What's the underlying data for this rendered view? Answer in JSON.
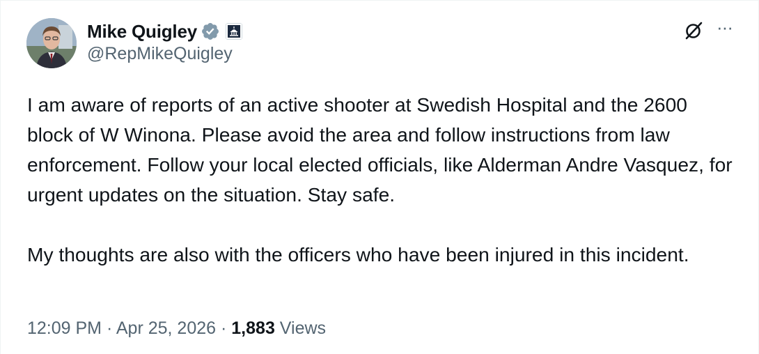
{
  "author": {
    "display_name": "Mike Quigley",
    "handle": "@RepMikeQuigley",
    "verified_icon": "verified-badge-icon",
    "affiliation_icon": "capitol-building-icon"
  },
  "tweet": {
    "text": "I am aware of reports of an active shooter at Swedish Hospital and the 2600 block of W Winona. Please avoid the area and follow instructions from law enforcement. Follow your local elected officials, like Alderman Andre Vasquez, for urgent updates on the situation. Stay safe.\n\nMy thoughts are also with the officers who have been injured in this incident.",
    "time": "12:09 PM",
    "separator": "·",
    "date": "Apr 25, 2026",
    "views_count": "1,883",
    "views_label": "Views"
  },
  "actions": {
    "grok_icon": "grok-icon",
    "more_icon": "more-icon",
    "more_label": "···"
  },
  "colors": {
    "text_primary": "#0f1419",
    "text_secondary": "#536471",
    "verified": "#1d9bf0"
  }
}
